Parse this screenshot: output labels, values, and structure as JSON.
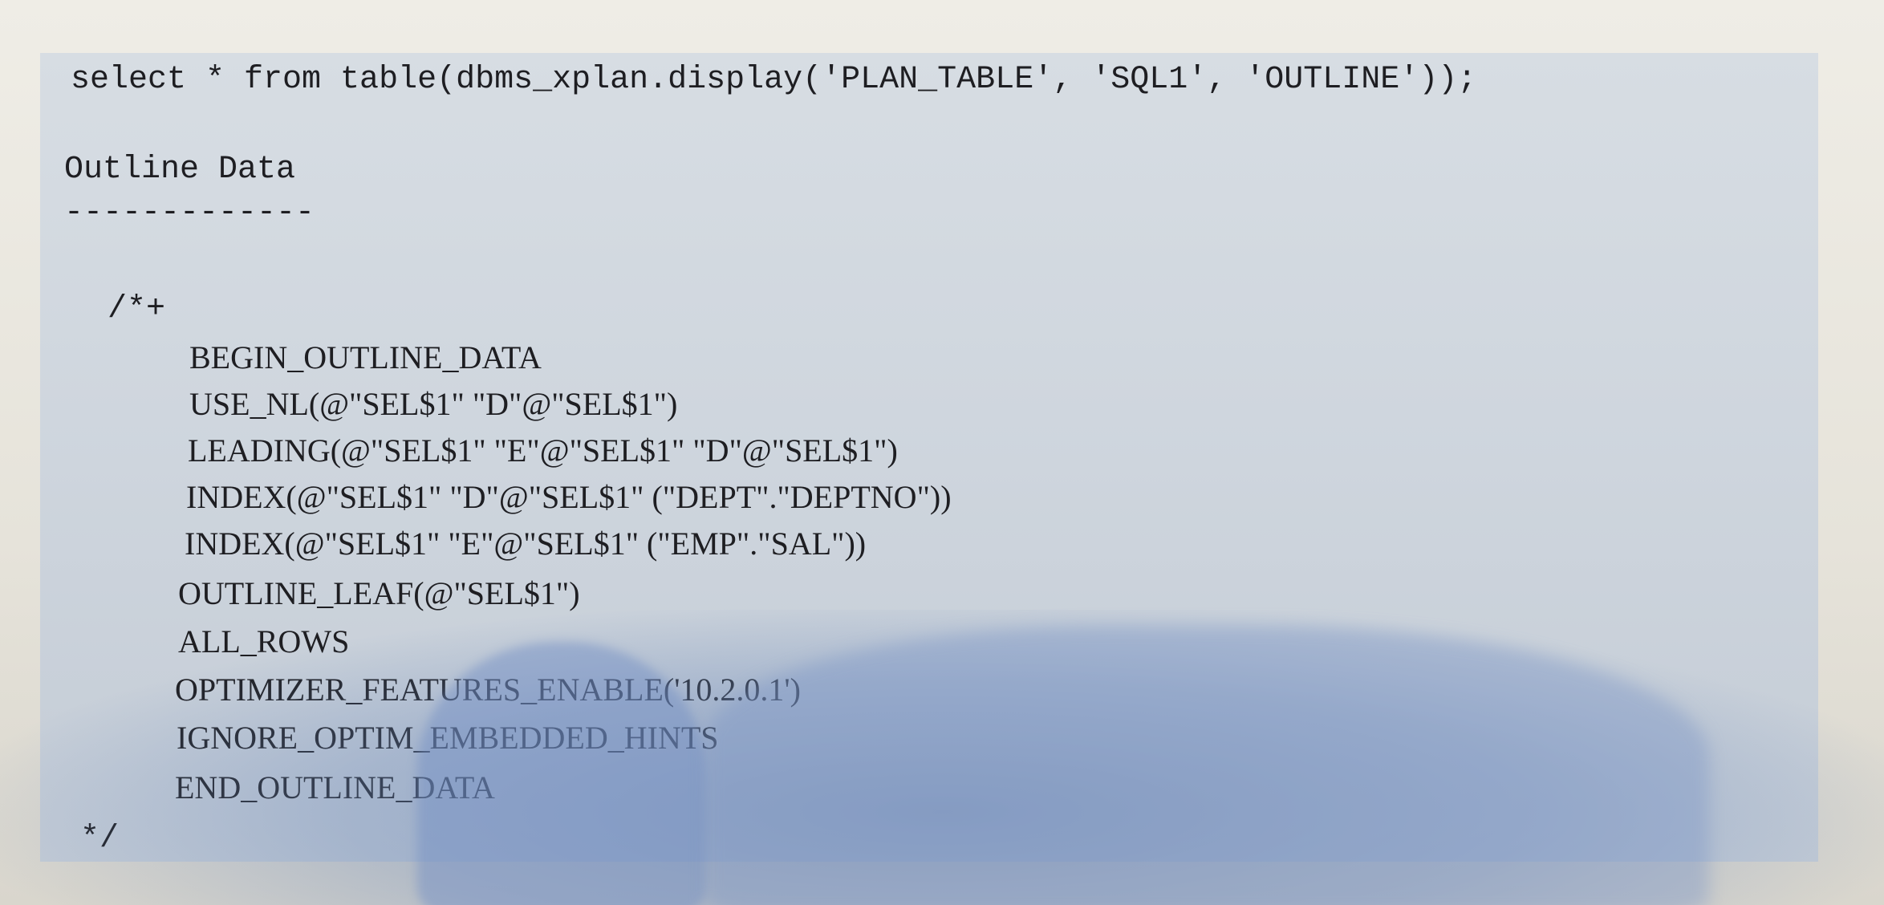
{
  "code": {
    "query": "select * from table(dbms_xplan.display('PLAN_TABLE', 'SQL1', 'OUTLINE'));",
    "section_title": "Outline Data",
    "section_rule": "-------------",
    "hint_open": "/*+",
    "hints": [
      "BEGIN_OUTLINE_DATA",
      "USE_NL(@\"SEL$1\" \"D\"@\"SEL$1\")",
      "LEADING(@\"SEL$1\" \"E\"@\"SEL$1\" \"D\"@\"SEL$1\")",
      "INDEX(@\"SEL$1\" \"D\"@\"SEL$1\" (\"DEPT\".\"DEPTNO\"))",
      "INDEX(@\"SEL$1\" \"E\"@\"SEL$1\" (\"EMP\".\"SAL\"))",
      "OUTLINE_LEAF(@\"SEL$1\")",
      "ALL_ROWS",
      "OPTIMIZER_FEATURES_ENABLE('10.2.0.1')",
      "IGNORE_OPTIM_EMBEDDED_HINTS",
      "END_OUTLINE_DATA"
    ],
    "hint_close": "*/"
  }
}
